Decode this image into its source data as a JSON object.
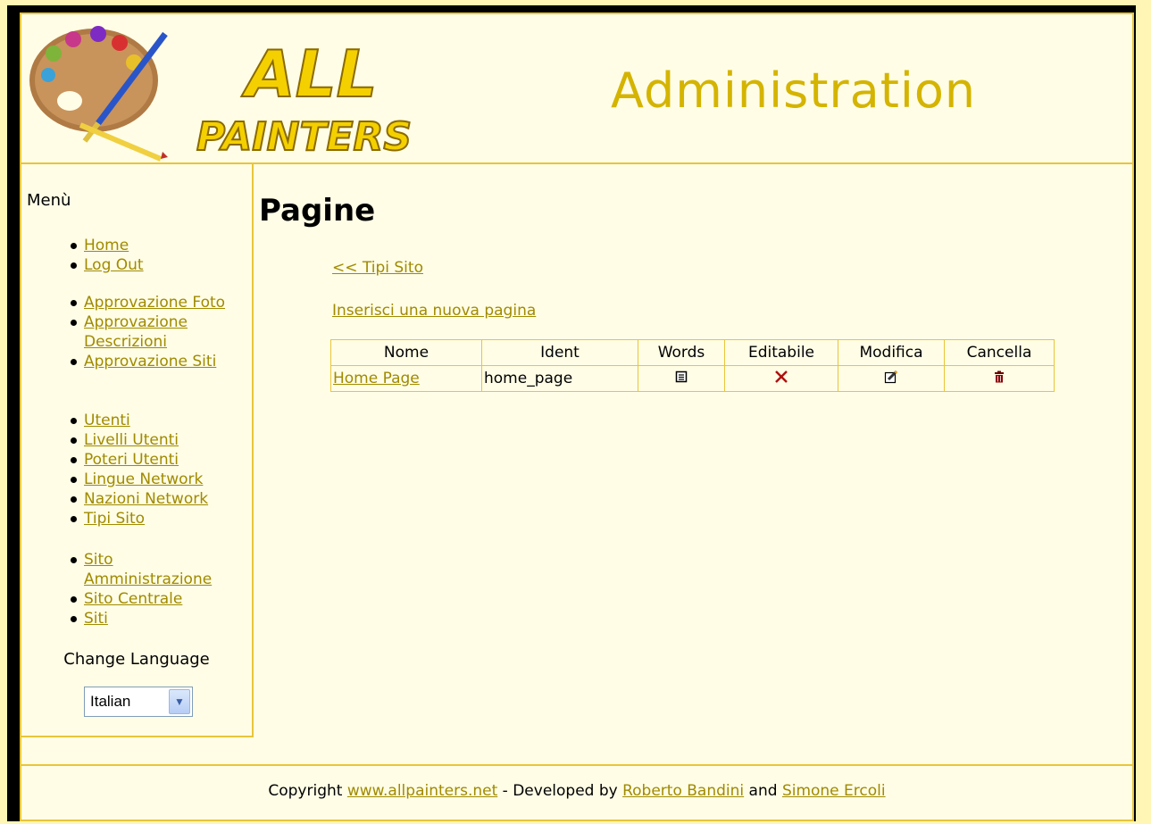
{
  "header": {
    "logo_line1": "ALL",
    "logo_line2": "PAINTERS",
    "title": "Administration"
  },
  "sidebar": {
    "heading": "Menù",
    "group1": [
      "Home",
      "Log Out"
    ],
    "group2": [
      "Approvazione Foto",
      "Approvazione Descrizioni",
      "Approvazione Siti"
    ],
    "group3": [
      "Utenti",
      "Livelli Utenti",
      "Poteri Utenti",
      "Lingue Network",
      "Nazioni Network",
      "Tipi Sito"
    ],
    "group4": [
      "Sito Amministrazione",
      "Sito Centrale",
      "Siti"
    ],
    "language_label": "Change Language",
    "language_value": "Italian"
  },
  "main": {
    "title": "Pagine",
    "back_link": "<< Tipi Sito",
    "new_link": "Inserisci una nuova pagina",
    "table": {
      "headers": [
        "Nome",
        "Ident",
        "Words",
        "Editabile",
        "Modifica",
        "Cancella"
      ],
      "rows": [
        {
          "nome": "Home Page",
          "ident": "home_page",
          "words_icon": "list-icon",
          "editabile_icon": "x-icon",
          "modifica_icon": "edit-icon",
          "cancella_icon": "trash-icon"
        }
      ]
    }
  },
  "footer": {
    "prefix": "Copyright ",
    "site_link": "www.allpainters.net",
    "middle": " - Developed by ",
    "author1": "Roberto Bandini",
    "and": " and ",
    "author2": "Simone Ercoli"
  },
  "colors": {
    "accent": "#d4b400",
    "border": "#e8c53a",
    "background": "#fffde6",
    "outer": "#fff6b5"
  }
}
